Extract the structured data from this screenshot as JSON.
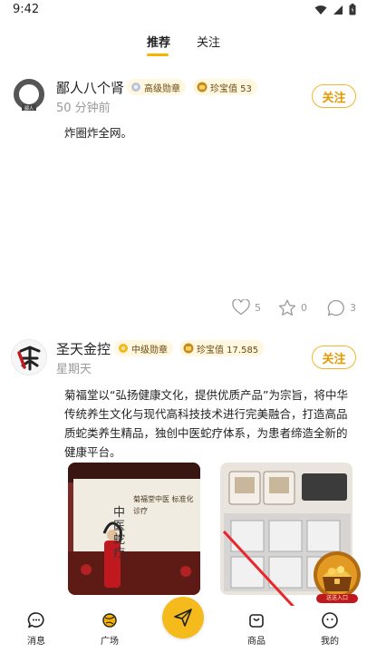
{
  "status_bar": {
    "time": "9:42"
  },
  "tabs": [
    {
      "label": "推荐",
      "active": true
    },
    {
      "label": "关注",
      "active": false
    }
  ],
  "posts": [
    {
      "username": "鄙人八个肾",
      "level_badge": "高级勋章",
      "treasure_badge": "珍宝值 53",
      "time": "50 分钟前",
      "follow_label": "关注",
      "text": "炸圈炸全网。",
      "likes": "5",
      "favorites": "0",
      "comments": "3"
    },
    {
      "username": "圣天金控",
      "level_badge": "中级勋章",
      "treasure_badge": "珍宝值 17.585",
      "time": "星期天",
      "follow_label": "关注",
      "text": "菊福堂以“弘扬健康文化，提供优质产品”为宗旨，将中华传统养生文化与现代高科技技术进行完美融合，打造高品质蛇类养生精品，独创中医蛇疗体系，为患者缔造全新的健康平台。",
      "image1_text": "菊福堂中医 标准化诊疗",
      "image1_script": "中医蛇疗"
    }
  ],
  "promo": {
    "label": "送送入口"
  },
  "bottom_nav": {
    "items": [
      {
        "label": "消息"
      },
      {
        "label": "广场"
      },
      {
        "label": "商品"
      },
      {
        "label": "我的"
      }
    ]
  },
  "colors": {
    "accent": "#f6b400",
    "follow_border": "#f4b52a",
    "muted": "#9a9a9a",
    "arrow": "#e8262b"
  }
}
